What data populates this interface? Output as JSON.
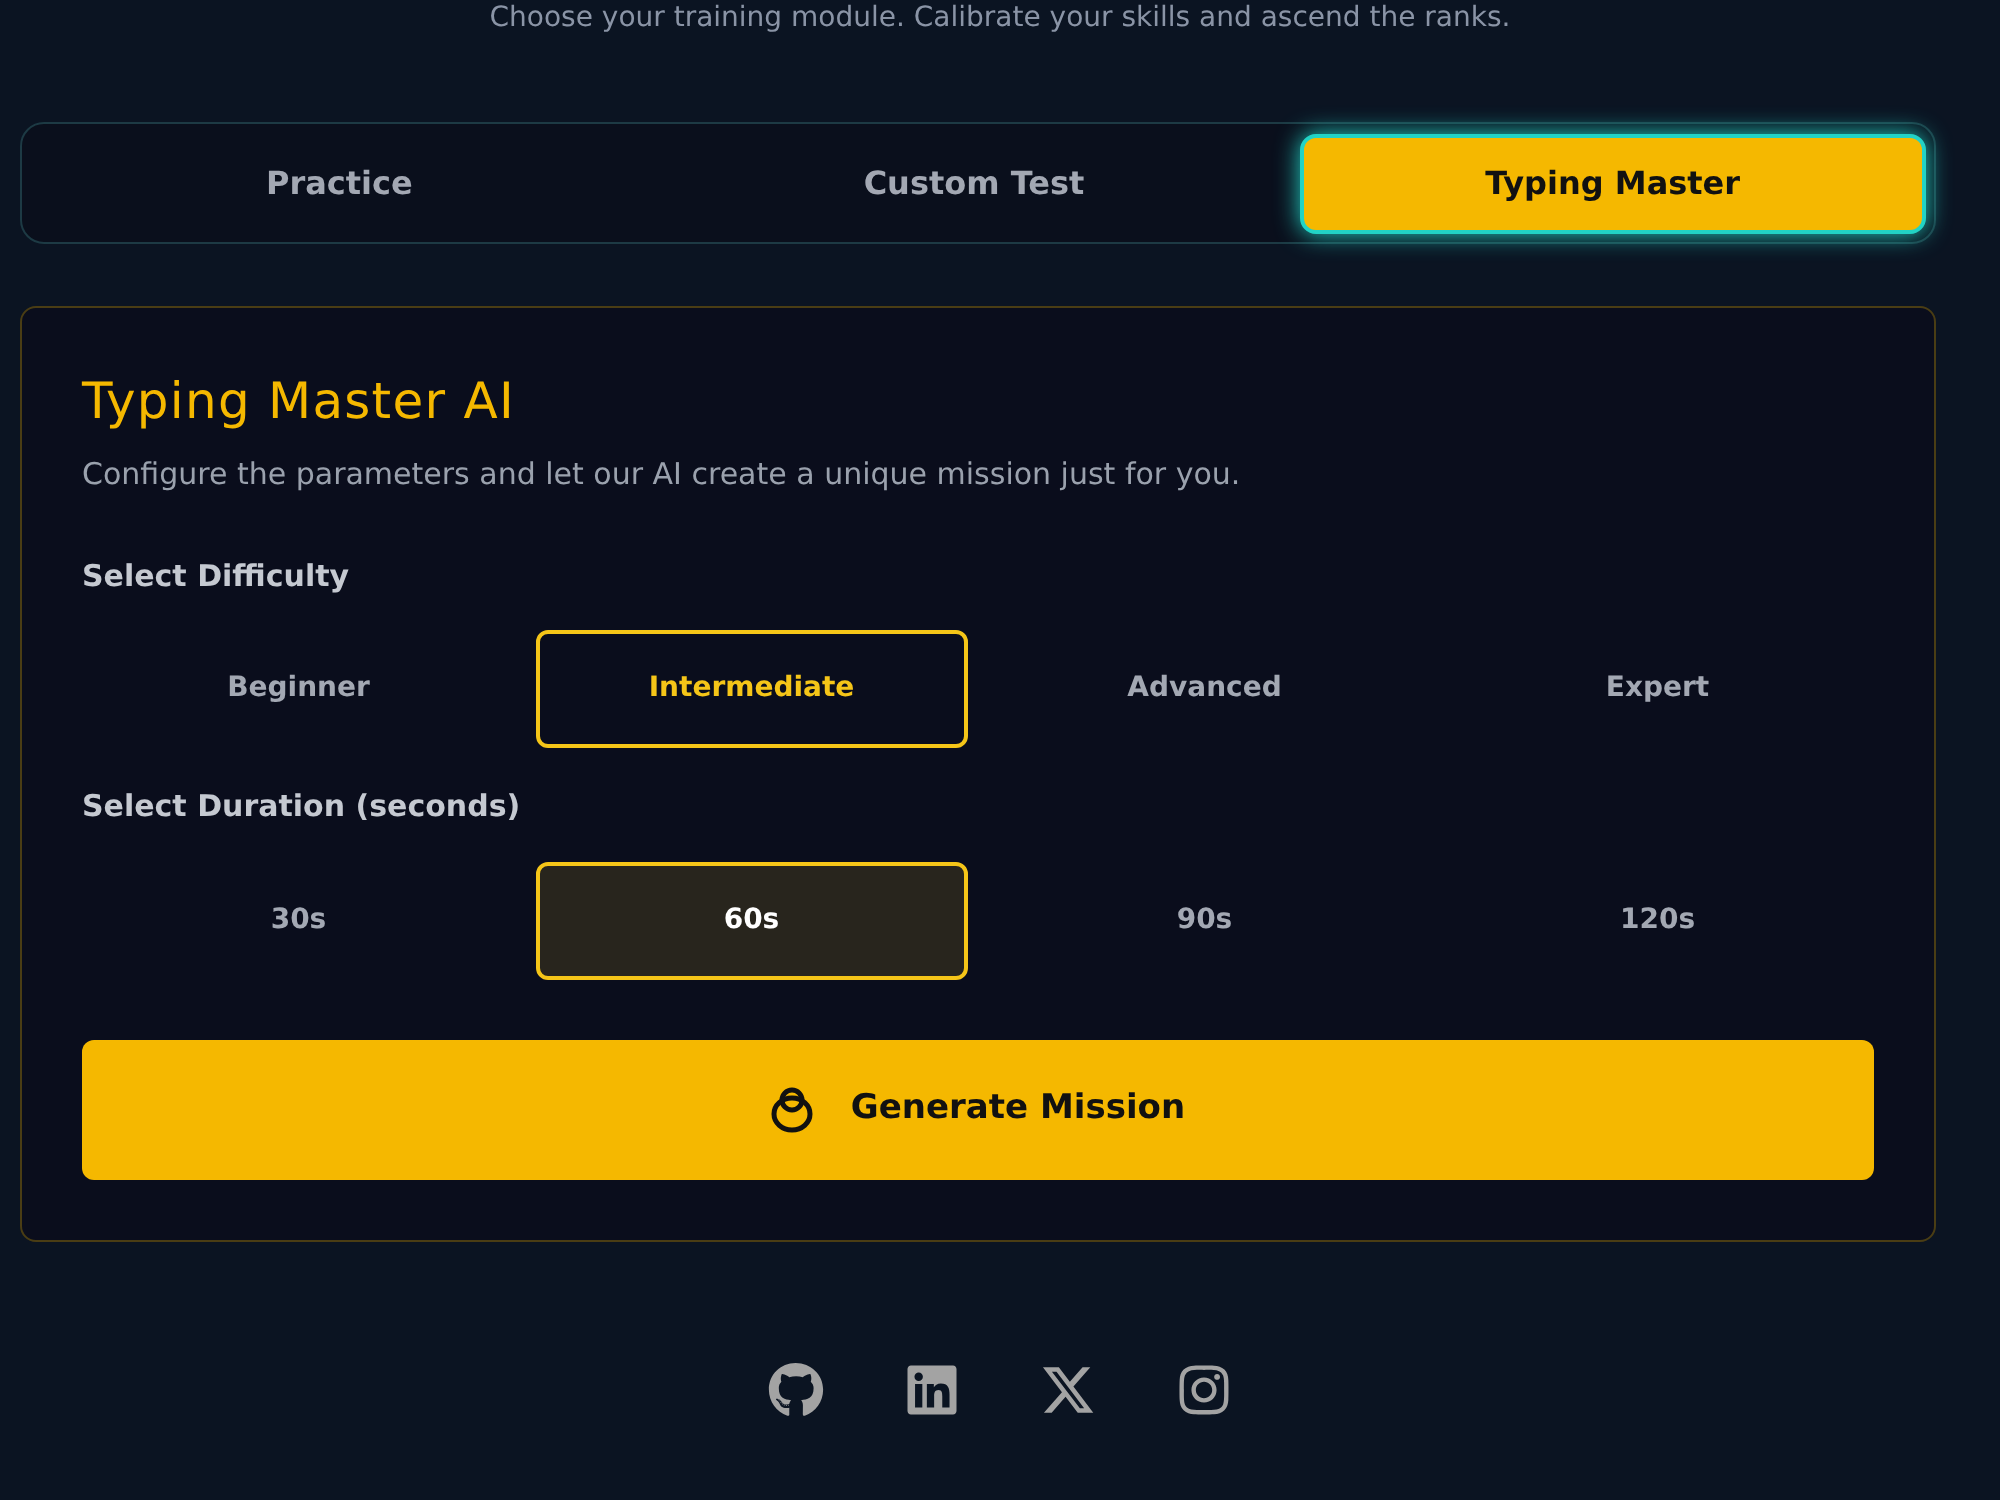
{
  "subtitle": "Choose your training module. Calibrate your skills and ascend the ranks.",
  "tabs": [
    {
      "label": "Practice",
      "selected": false
    },
    {
      "label": "Custom Test",
      "selected": false
    },
    {
      "label": "Typing Master",
      "selected": true
    }
  ],
  "panel": {
    "title": "Typing Master AI",
    "description": "Configure the parameters and let our AI create a unique mission just for you.",
    "difficulty": {
      "label": "Select Difficulty",
      "options": [
        {
          "label": "Beginner",
          "selected": false
        },
        {
          "label": "Intermediate",
          "selected": true
        },
        {
          "label": "Advanced",
          "selected": false
        },
        {
          "label": "Expert",
          "selected": false
        }
      ]
    },
    "duration": {
      "label": "Select Duration (seconds)",
      "options": [
        {
          "label": "30s",
          "selected": false
        },
        {
          "label": "60s",
          "selected": true
        },
        {
          "label": "90s",
          "selected": false
        },
        {
          "label": "120s",
          "selected": false
        }
      ]
    },
    "button": "Generate Mission"
  },
  "social": [
    {
      "kind": "github"
    },
    {
      "kind": "linkedin"
    },
    {
      "kind": "x"
    },
    {
      "kind": "instagram"
    }
  ]
}
